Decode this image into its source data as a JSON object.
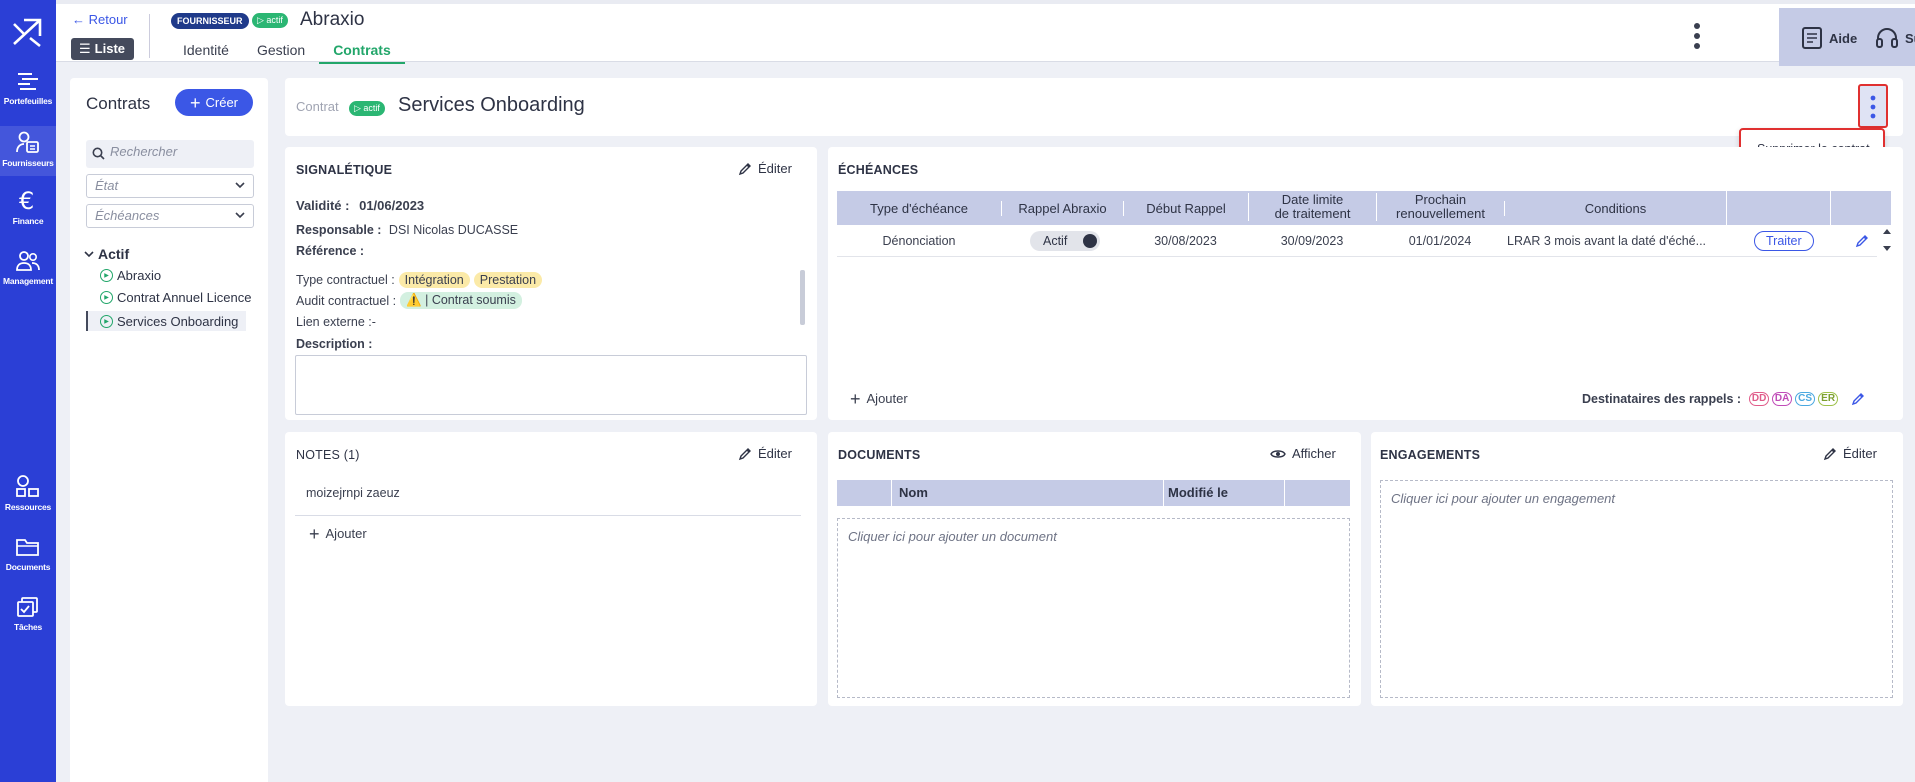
{
  "nav": {
    "items": [
      {
        "label": "Portefeuilles",
        "icon": "bars-icon"
      },
      {
        "label": "Fournisseurs",
        "icon": "supplier-icon"
      },
      {
        "label": "Finance",
        "icon": "euro-icon"
      },
      {
        "label": "Management",
        "icon": "users-icon"
      },
      {
        "label": "Ressources",
        "icon": "shapes-icon"
      },
      {
        "label": "Documents",
        "icon": "folder-icon"
      },
      {
        "label": "Tâches",
        "icon": "tasks-icon"
      }
    ]
  },
  "header": {
    "back": "← Retour",
    "list": "Liste",
    "badge_type": "FOURNISSEUR",
    "badge_status": "▷ actif",
    "title": "Abraxio",
    "tabs": [
      "Identité",
      "Gestion",
      "Contrats"
    ],
    "active_tab": "Contrats",
    "help": "Aide",
    "support": "Support"
  },
  "contracts_panel": {
    "title": "Contrats",
    "create": "Créer",
    "search_placeholder": "Rechercher",
    "state_placeholder": "État",
    "deadline_placeholder": "Échéances",
    "group": "Actif",
    "items": [
      "Abraxio",
      "Contrat Annuel Licence",
      "Services Onboarding"
    ]
  },
  "contract": {
    "label": "Contrat",
    "status": "▷ actif",
    "name": "Services Onboarding",
    "menu_item": "Supprimer le contrat"
  },
  "signaletique": {
    "title": "SIGNALÉTIQUE",
    "edit": "Éditer",
    "validity_label": "Validité :",
    "validity": "01/06/2023",
    "responsible_label": "Responsable :",
    "responsible": "DSI Nicolas DUCASSE",
    "reference_label": "Référence :",
    "type_label": "Type contractuel :",
    "tags": [
      "Intégration",
      "Prestation"
    ],
    "audit_label": "Audit contractuel :",
    "audit_value": "⚠️ | Contrat soumis",
    "link_label": "Lien externe :-",
    "description_label": "Description :"
  },
  "echeances": {
    "title": "ÉCHÉANCES",
    "columns": [
      "Type d'échéance",
      "Rappel Abraxio",
      "Début Rappel",
      "Date limite\nde traitement",
      "Prochain\nrenouvellement",
      "Conditions"
    ],
    "row": {
      "type": "Dénonciation",
      "rappel": "Actif",
      "debut": "30/08/2023",
      "limite": "30/09/2023",
      "prochain": "01/01/2024",
      "conditions": "LRAR 3 mois avant la daté d'éché...",
      "action": "Traiter"
    },
    "add": "Ajouter",
    "recipients_label": "Destinataires des rappels :",
    "recipients": [
      "DD",
      "DA",
      "CS",
      "ER"
    ]
  },
  "notes": {
    "title": "NOTES (1)",
    "edit": "Éditer",
    "note": "moizejrnpi zaeuz",
    "add": "Ajouter"
  },
  "documents": {
    "title": "DOCUMENTS",
    "show": "Afficher",
    "columns": [
      "Nom",
      "Modifié le"
    ],
    "empty": "Cliquer ici pour ajouter un document"
  },
  "engagements": {
    "title": "ENGAGEMENTS",
    "edit": "Éditer",
    "empty": "Cliquer ici pour ajouter un engagement"
  },
  "colors": {
    "primary": "#2b3fd6",
    "accent": "#22a66a",
    "header_table": "#c5cbe6",
    "danger": "#e03030"
  }
}
